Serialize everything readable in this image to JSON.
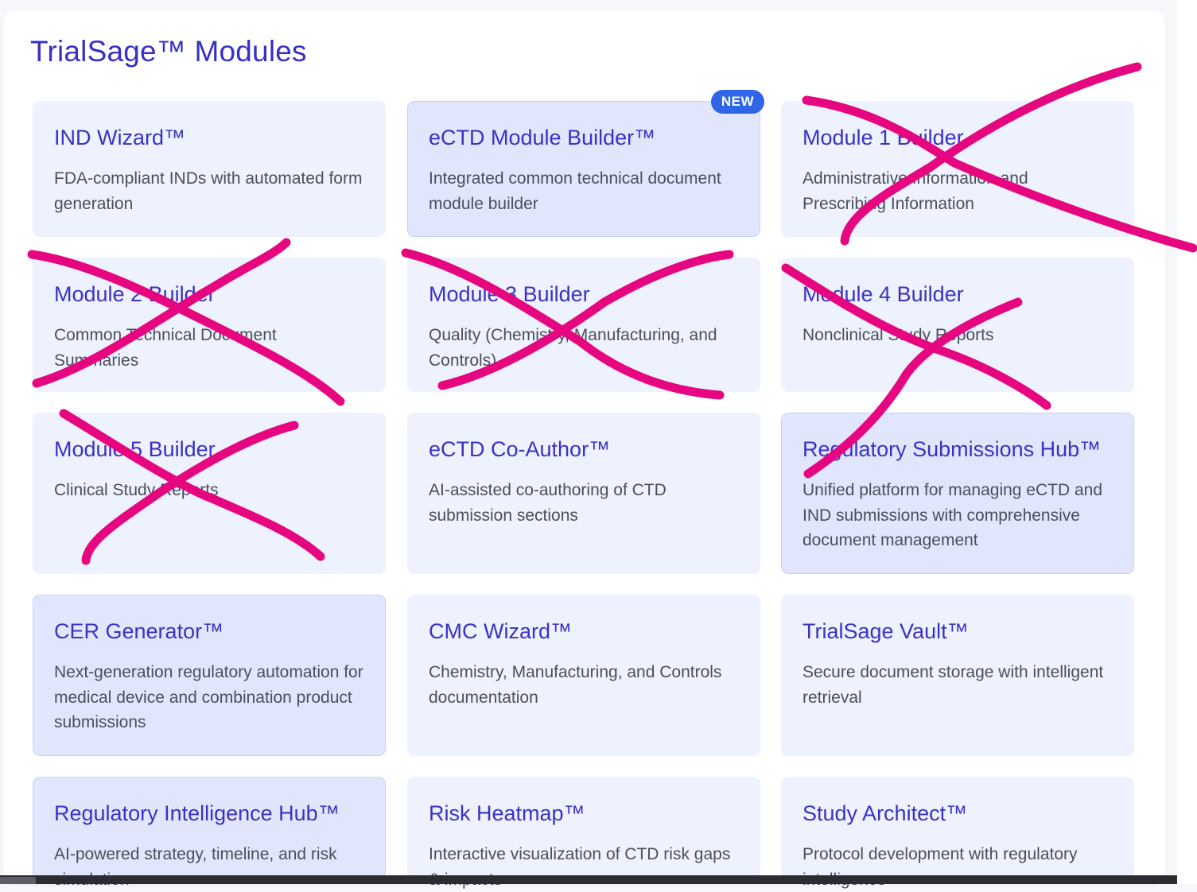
{
  "page": {
    "heading": "TrialSage™ Modules",
    "accent_color": "#3730c4",
    "badge_color": "#2f66e8",
    "annotation_color": "#e6067f"
  },
  "modules": [
    {
      "title": "IND Wizard™",
      "description": "FDA-compliant INDs with automated form generation"
    },
    {
      "title": "eCTD Module Builder™",
      "description": "Integrated common technical document module builder",
      "badge": "NEW"
    },
    {
      "title": "Module 1 Builder",
      "description": "Administrative Information and Prescribing Information",
      "crossed_out": true
    },
    {
      "title": "Module 2 Builder",
      "description": "Common Technical Document Summaries",
      "crossed_out": true
    },
    {
      "title": "Module 3 Builder",
      "description": "Quality (Chemistry, Manufacturing, and Controls)",
      "crossed_out": true
    },
    {
      "title": "Module 4 Builder",
      "description": "Nonclinical Study Reports",
      "crossed_out": true
    },
    {
      "title": "Module 5 Builder",
      "description": "Clinical Study Reports",
      "crossed_out": true
    },
    {
      "title": "eCTD Co-Author™",
      "description": "AI-assisted co-authoring of CTD submission sections"
    },
    {
      "title": "Regulatory Submissions Hub™",
      "description": "Unified platform for managing eCTD and IND submissions with comprehensive document management"
    },
    {
      "title": "CER Generator™",
      "description": "Next-generation regulatory automation for medical device and combination product submissions"
    },
    {
      "title": "CMC Wizard™",
      "description": "Chemistry, Manufacturing, and Controls documentation"
    },
    {
      "title": "TrialSage Vault™",
      "description": "Secure document storage with intelligent retrieval"
    },
    {
      "title": "Regulatory Intelligence Hub™",
      "description": "AI-powered strategy, timeline, and risk simulation"
    },
    {
      "title": "Risk Heatmap™",
      "description": "Interactive visualization of CTD risk gaps & impacts"
    },
    {
      "title": "Study Architect™",
      "description": "Protocol development with regulatory intelligence"
    }
  ]
}
